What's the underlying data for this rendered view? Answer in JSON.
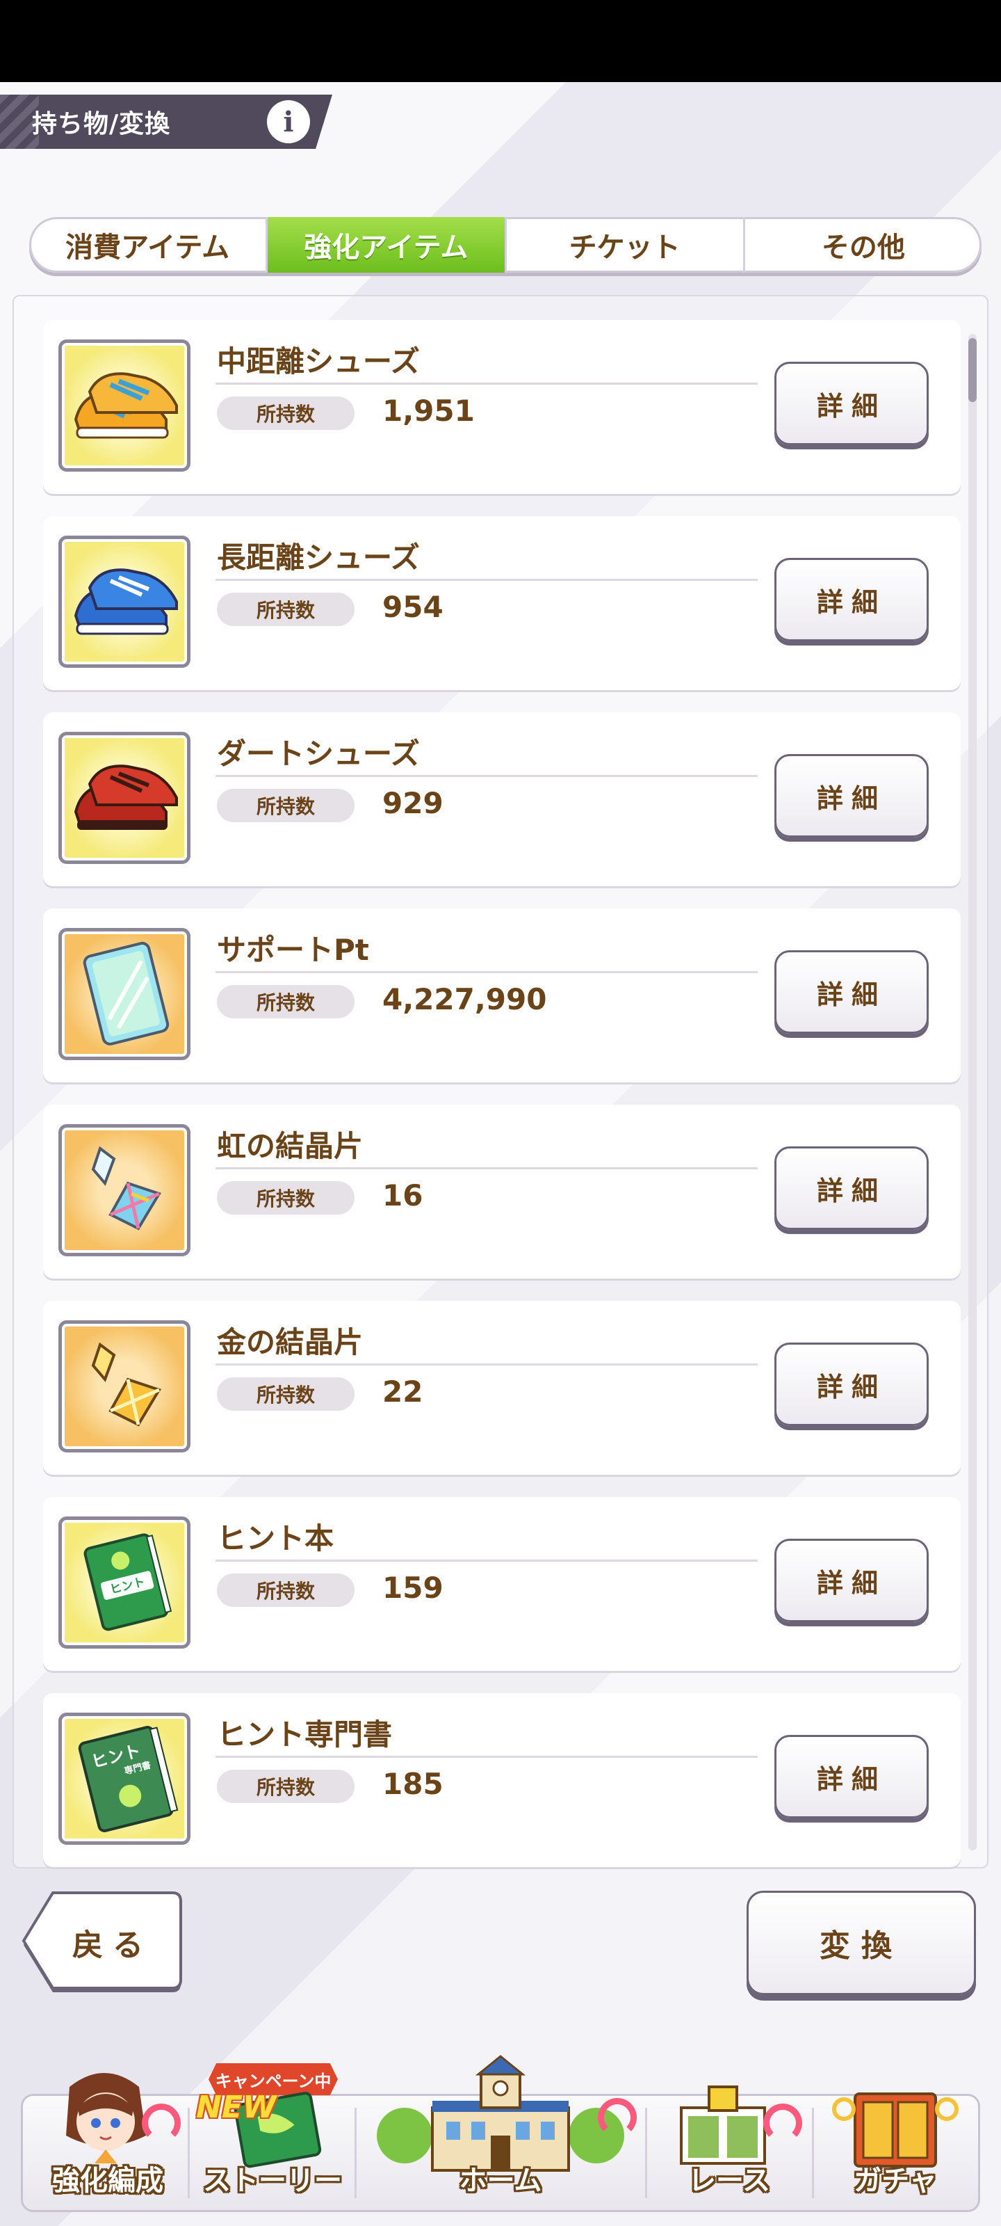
{
  "header": {
    "title": "持ち物/変換",
    "info_icon": "i"
  },
  "tabs": [
    {
      "label": "消費アイテム",
      "active": false
    },
    {
      "label": "強化アイテム",
      "active": true
    },
    {
      "label": "チケット",
      "active": false
    },
    {
      "label": "その他",
      "active": false
    }
  ],
  "qty_label": "所持数",
  "detail_label": "詳細",
  "items": [
    {
      "name": "中距離シューズ",
      "qty": "1,951",
      "icon": "orange-shoes-icon"
    },
    {
      "name": "長距離シューズ",
      "qty": "954",
      "icon": "blue-shoes-icon"
    },
    {
      "name": "ダートシューズ",
      "qty": "929",
      "icon": "red-shoes-icon"
    },
    {
      "name": "サポートPt",
      "qty": "4,227,990",
      "icon": "support-card-icon"
    },
    {
      "name": "虹の結晶片",
      "qty": "16",
      "icon": "rainbow-crystal-icon"
    },
    {
      "name": "金の結晶片",
      "qty": "22",
      "icon": "gold-crystal-icon"
    },
    {
      "name": "ヒント本",
      "qty": "159",
      "icon": "hint-book-icon"
    },
    {
      "name": "ヒント専門書",
      "qty": "185",
      "icon": "hint-expert-book-icon"
    }
  ],
  "icon_text": {
    "hint_book": "ヒント",
    "hint_expert": "ヒント",
    "hint_expert_sub": "専門書"
  },
  "buttons": {
    "back": "戻る",
    "exchange": "変換"
  },
  "nav": {
    "items": [
      {
        "label": "強化編成"
      },
      {
        "label": "ストーリー"
      },
      {
        "label": "ホーム"
      },
      {
        "label": "レース"
      },
      {
        "label": "ガチャ"
      }
    ],
    "campaign_badge": "キャンペーン中",
    "new_badge": "NEW"
  },
  "colors": {
    "accent_green": "#7cc52a",
    "text_brown": "#6a4318",
    "header_bg": "#514a5d"
  }
}
